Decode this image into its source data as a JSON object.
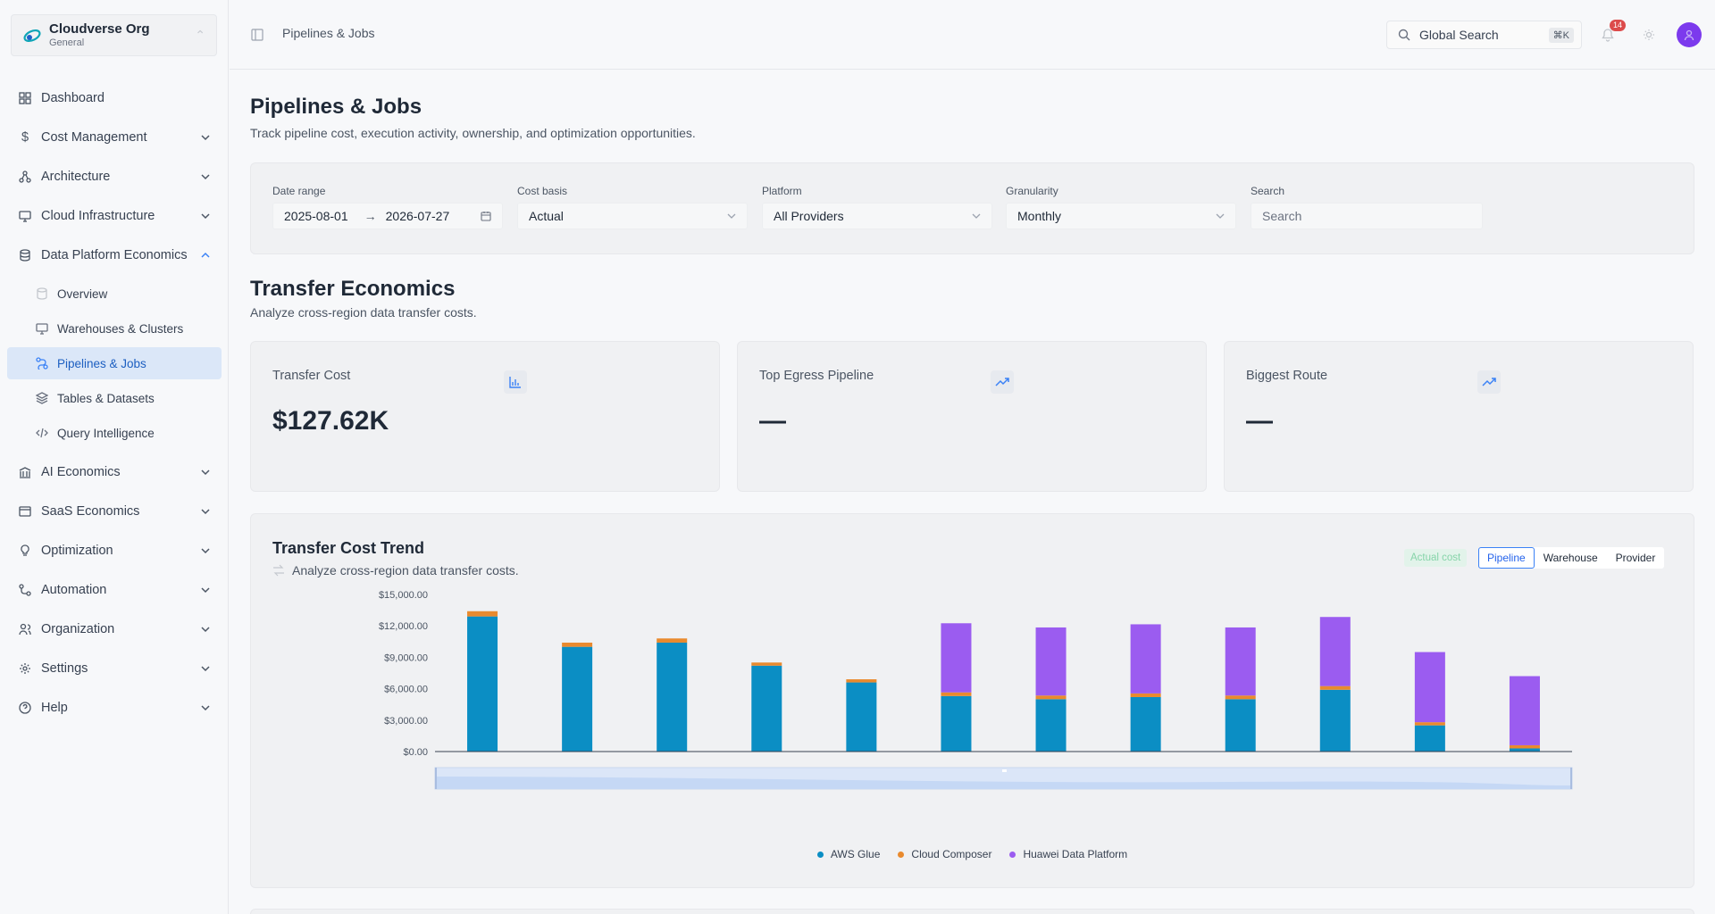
{
  "org": {
    "name": "Cloudverse Org",
    "workspace": "General"
  },
  "nav": {
    "dashboard": "Dashboard",
    "cost_management": "Cost Management",
    "architecture": "Architecture",
    "cloud_infrastructure": "Cloud Infrastructure",
    "data_platform": "Data Platform Economics",
    "sub": {
      "overview": "Overview",
      "warehouses": "Warehouses & Clusters",
      "pipelines": "Pipelines & Jobs",
      "tables": "Tables & Datasets",
      "query": "Query Intelligence"
    },
    "ai_economics": "AI Economics",
    "saas_economics": "SaaS Economics",
    "optimization": "Optimization",
    "automation": "Automation",
    "organization": "Organization",
    "settings": "Settings",
    "help": "Help"
  },
  "topbar": {
    "breadcrumb": "Pipelines & Jobs",
    "search_label": "Global Search",
    "shortcut": "⌘K",
    "notifications": "14"
  },
  "page": {
    "title": "Pipelines & Jobs",
    "subtitle": "Track pipeline cost, execution activity, ownership, and optimization opportunities."
  },
  "filters": {
    "date_range_label": "Date range",
    "date_from": "2025-08-01",
    "date_to": "2026-07-27",
    "cost_basis_label": "Cost basis",
    "cost_basis": "Actual",
    "platform_label": "Platform",
    "platform": "All Providers",
    "granularity_label": "Granularity",
    "granularity": "Monthly",
    "search_label": "Search",
    "search_placeholder": "Search"
  },
  "section": {
    "title": "Transfer Economics",
    "subtitle": "Analyze cross-region data transfer costs."
  },
  "kpis": {
    "transfer_cost_label": "Transfer Cost",
    "transfer_cost_value": "$127.62K",
    "top_egress_label": "Top Egress Pipeline",
    "top_egress_value": "—",
    "biggest_route_label": "Biggest Route",
    "biggest_route_value": "—"
  },
  "chart_card": {
    "title": "Transfer Cost Trend",
    "subtitle": "Analyze cross-region data transfer costs.",
    "actual_tag": "Actual cost",
    "seg_pipeline": "Pipeline",
    "seg_warehouse": "Warehouse",
    "seg_provider": "Provider"
  },
  "colors": {
    "aws_glue": "#0b8ec4",
    "cloud_composer": "#e98a2e",
    "huawei": "#9b5cf0",
    "accent": "#3b82f6"
  },
  "chart_data": {
    "type": "bar",
    "stacked": true,
    "categories": [
      "",
      "",
      "",
      "",
      "",
      "",
      "",
      "",
      "",
      "",
      "",
      ""
    ],
    "series": [
      {
        "name": "AWS Glue",
        "values": [
          12900,
          10000,
          10400,
          8200,
          6600,
          5300,
          5000,
          5200,
          5000,
          5900,
          2500,
          300
        ]
      },
      {
        "name": "Cloud Composer",
        "values": [
          500,
          400,
          400,
          300,
          300,
          350,
          350,
          350,
          350,
          350,
          300,
          300
        ]
      },
      {
        "name": "Huawei Data Platform",
        "values": [
          0,
          0,
          0,
          0,
          0,
          6600,
          6500,
          6600,
          6500,
          6600,
          6700,
          6600
        ]
      }
    ],
    "yticks": [
      "$0.00",
      "$3,000.00",
      "$6,000.00",
      "$9,000.00",
      "$12,000.00",
      "$15,000.00"
    ],
    "ylim": [
      0,
      15000
    ],
    "grid": false,
    "legend": "bottom-center"
  }
}
